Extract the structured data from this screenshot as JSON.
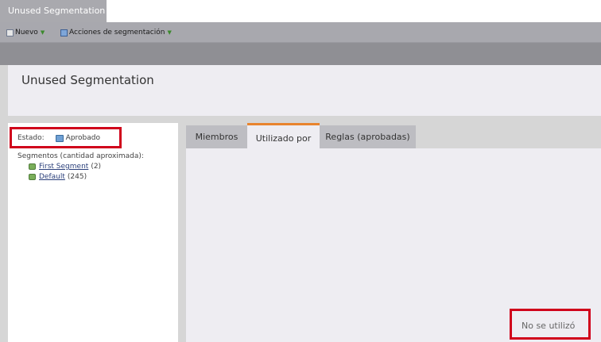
{
  "window": {
    "tab_title": "Unused Segmentation"
  },
  "toolbar": {
    "new_label": "Nuevo",
    "actions_label": "Acciones de segmentación",
    "caret": "▼"
  },
  "header": {
    "title": "Unused Segmentation"
  },
  "left_panel": {
    "status_label": "Estado:",
    "status_value": "Aprobado",
    "segments_label": "Segmentos (cantidad aproximada):",
    "segments": [
      {
        "name": "First Segment",
        "count": "(2)"
      },
      {
        "name": "Default",
        "count": "(245)"
      }
    ]
  },
  "tabs": [
    {
      "label": "Miembros"
    },
    {
      "label": "Utilizado por"
    },
    {
      "label": "Reglas (aprobadas)"
    }
  ],
  "content": {
    "empty_text": "No se utilizó"
  },
  "colors": {
    "highlight": "#d0021b",
    "active_tab_accent": "#e8842e"
  }
}
